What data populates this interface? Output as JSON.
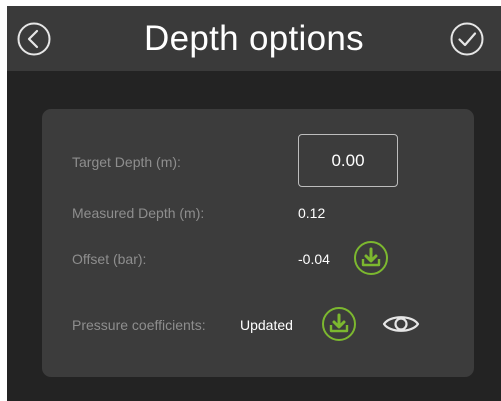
{
  "header": {
    "title": "Depth options",
    "back_icon": "chevron-left-circle-icon",
    "confirm_icon": "check-circle-icon"
  },
  "form": {
    "target_depth": {
      "label": "Target Depth (m):",
      "value": "0.00"
    },
    "measured_depth": {
      "label": "Measured Depth (m):",
      "value": "0.12"
    },
    "offset": {
      "label": "Offset (bar):",
      "value": "-0.04",
      "action_icon": "download-icon"
    },
    "pressure_coefficients": {
      "label": "Pressure coefficients:",
      "value": "Updated",
      "action_icon": "download-icon",
      "view_icon": "eye-icon"
    }
  },
  "colors": {
    "background": "#232323",
    "header": "#3a3a3a",
    "panel": "#3c3c3c",
    "label_text": "#8e8e8e",
    "value_text": "#ffffff",
    "accent_green": "#7cb82f"
  }
}
